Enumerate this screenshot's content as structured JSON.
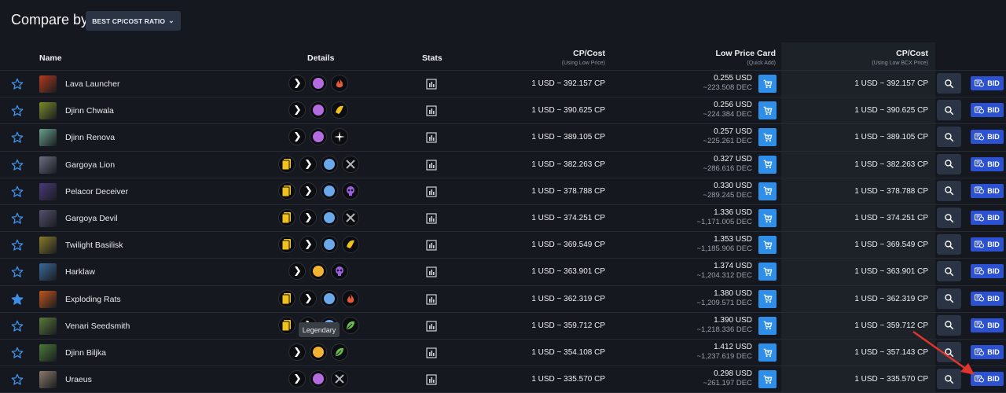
{
  "header": {
    "title": "Compare by",
    "compare_select": "BEST CP/COST RATIO"
  },
  "columns": {
    "name": "Name",
    "details": "Details",
    "stats": "Stats",
    "cp_cost": "CP/Cost",
    "cp_cost_sub": "(Using Low Price)",
    "low_price": "Low Price Card",
    "low_price_sub": "(Quick Add)",
    "bcx_cp_cost": "CP/Cost",
    "bcx_cp_cost_sub": "(Using Low BCX Price)"
  },
  "bid_label": "BID",
  "tooltip": "Legendary",
  "rows": [
    {
      "name": "Lava Launcher",
      "favorite": false,
      "avatar_color": "#b33a1c",
      "details": [
        "summoner-icon",
        "rarity-epic-icon",
        "fire-element-icon"
      ],
      "cp": "1 USD ~ 392.157 CP",
      "usd": "0.255 USD",
      "dec": "~223.508 DEC",
      "bcx_cp": "1 USD ~ 392.157 CP"
    },
    {
      "name": "Djinn Chwala",
      "favorite": false,
      "avatar_color": "#7a8a2a",
      "details": [
        "summoner-icon",
        "rarity-epic-icon",
        "gold-foil-icon"
      ],
      "cp": "1 USD ~ 390.625 CP",
      "usd": "0.256 USD",
      "dec": "~224.384 DEC",
      "bcx_cp": "1 USD ~ 390.625 CP"
    },
    {
      "name": "Djinn Renova",
      "favorite": false,
      "avatar_color": "#6aa08c",
      "details": [
        "summoner-icon",
        "rarity-epic-icon",
        "life-element-icon"
      ],
      "cp": "1 USD ~ 389.105 CP",
      "usd": "0.257 USD",
      "dec": "~225.261 DEC",
      "bcx_cp": "1 USD ~ 389.105 CP"
    },
    {
      "name": "Gargoya Lion",
      "favorite": false,
      "avatar_color": "#6a6e82",
      "details": [
        "card-edition-icon",
        "summoner-icon",
        "rarity-rare-icon",
        "neutral-element-icon"
      ],
      "cp": "1 USD ~ 382.263 CP",
      "usd": "0.327 USD",
      "dec": "~286.616 DEC",
      "bcx_cp": "1 USD ~ 382.263 CP"
    },
    {
      "name": "Pelacor Deceiver",
      "favorite": false,
      "avatar_color": "#4a3a7a",
      "details": [
        "card-edition-icon",
        "summoner-icon",
        "rarity-rare-icon",
        "death-element-icon"
      ],
      "cp": "1 USD ~ 378.788 CP",
      "usd": "0.330 USD",
      "dec": "~289.245 DEC",
      "bcx_cp": "1 USD ~ 378.788 CP"
    },
    {
      "name": "Gargoya Devil",
      "favorite": false,
      "avatar_color": "#54506e",
      "details": [
        "card-edition-icon",
        "summoner-icon",
        "rarity-rare-icon",
        "neutral-element-icon"
      ],
      "cp": "1 USD ~ 374.251 CP",
      "usd": "1.336 USD",
      "dec": "~1,171.005 DEC",
      "bcx_cp": "1 USD ~ 374.251 CP"
    },
    {
      "name": "Twilight Basilisk",
      "favorite": false,
      "avatar_color": "#8a7a2a",
      "details": [
        "card-edition-icon",
        "summoner-icon",
        "rarity-rare-icon",
        "gold-foil-icon"
      ],
      "cp": "1 USD ~ 369.549 CP",
      "usd": "1.353 USD",
      "dec": "~1,185.906 DEC",
      "bcx_cp": "1 USD ~ 369.549 CP"
    },
    {
      "name": "Harklaw",
      "favorite": false,
      "avatar_color": "#3a6a9a",
      "details": [
        "summoner-icon",
        "rarity-legendary-icon",
        "death-element-icon"
      ],
      "cp": "1 USD ~ 363.901 CP",
      "usd": "1.374 USD",
      "dec": "~1,204.312 DEC",
      "bcx_cp": "1 USD ~ 363.901 CP"
    },
    {
      "name": "Exploding Rats",
      "favorite": true,
      "avatar_color": "#c0561c",
      "details": [
        "card-edition-icon",
        "summoner-icon",
        "rarity-rare-icon",
        "fire-element-icon"
      ],
      "cp": "1 USD ~ 362.319 CP",
      "usd": "1.380 USD",
      "dec": "~1,209.571 DEC",
      "bcx_cp": "1 USD ~ 362.319 CP"
    },
    {
      "name": "Venari Seedsmith",
      "favorite": false,
      "avatar_color": "#5a7a3a",
      "details": [
        "card-edition-icon",
        "summoner-icon",
        "rarity-rare-icon",
        "earth-element-icon"
      ],
      "cp": "1 USD ~ 359.712 CP",
      "usd": "1.390 USD",
      "dec": "~1,218.336 DEC",
      "bcx_cp": "1 USD ~ 359.712 CP"
    },
    {
      "name": "Djinn Biljka",
      "favorite": false,
      "avatar_color": "#4a7a3a",
      "details": [
        "summoner-icon",
        "rarity-legendary-icon",
        "earth-element-icon"
      ],
      "cp": "1 USD ~ 354.108 CP",
      "usd": "1.412 USD",
      "dec": "~1,237.619 DEC",
      "bcx_cp": "1 USD ~ 357.143 CP"
    },
    {
      "name": "Uraeus",
      "favorite": false,
      "avatar_color": "#8a7a6a",
      "details": [
        "summoner-icon",
        "rarity-epic-icon",
        "neutral-element-icon"
      ],
      "cp": "1 USD ~ 335.570 CP",
      "usd": "0.298 USD",
      "dec": "~261.197 DEC",
      "bcx_cp": "1 USD ~ 335.570 CP"
    }
  ]
}
